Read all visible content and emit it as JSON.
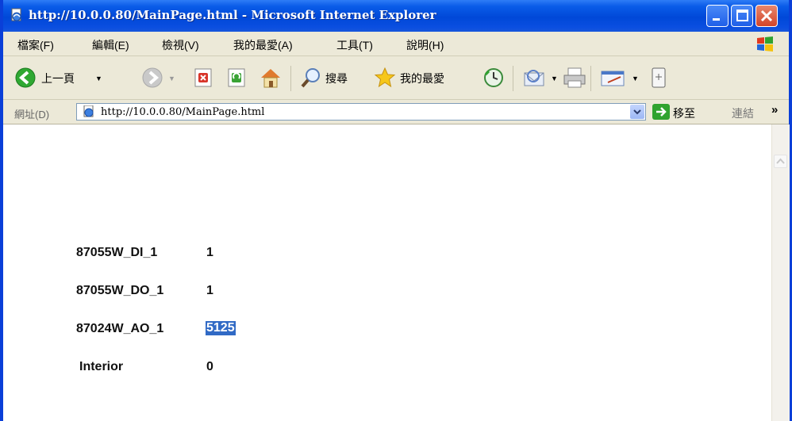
{
  "window": {
    "title": "http://10.0.0.80/MainPage.html - Microsoft Internet Explorer",
    "accent_color": "#0a3fd8"
  },
  "menu": {
    "items": [
      {
        "label": "檔案(F)"
      },
      {
        "label": "編輯(E)"
      },
      {
        "label": "檢視(V)"
      },
      {
        "label": "我的最愛(A)"
      },
      {
        "label": "工具(T)"
      },
      {
        "label": "說明(H)"
      }
    ]
  },
  "toolbar": {
    "back_label": "上一頁",
    "search_label": "搜尋",
    "favorites_label": "我的最愛"
  },
  "address": {
    "label": "網址(D)",
    "url": "http://10.0.0.80/MainPage.html",
    "go_label": "移至",
    "links_label": "連結",
    "more": "»"
  },
  "page": {
    "rows": [
      {
        "label": "87055W_DI_1",
        "value": "1"
      },
      {
        "label": "87055W_DO_1",
        "value": "1"
      },
      {
        "label": "87024W_AO_1",
        "value": "5125"
      },
      {
        "label": "Interior",
        "value": "0"
      }
    ]
  }
}
